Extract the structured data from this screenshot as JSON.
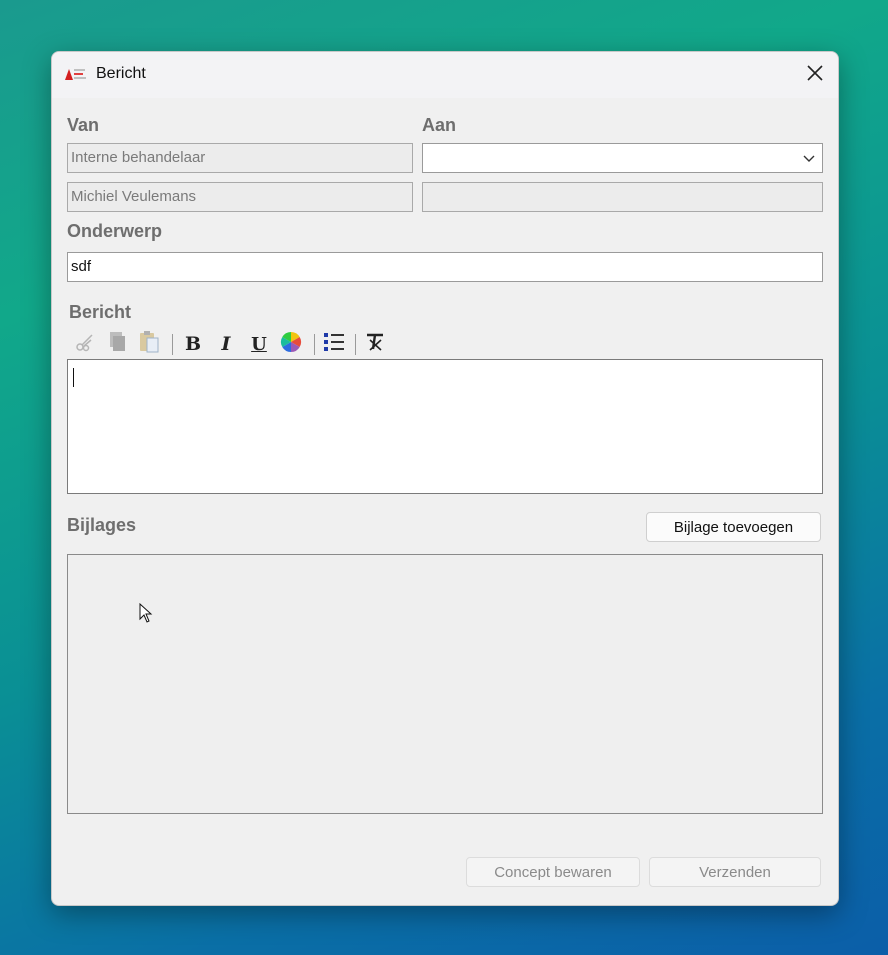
{
  "window": {
    "title": "Bericht"
  },
  "icons": {
    "app": "app-logo-icon",
    "close": "close-icon",
    "chevron": "chevron-down-icon",
    "cut": "scissors-icon",
    "copy": "copy-icon",
    "paste": "paste-icon",
    "bold": "bold-icon",
    "italic": "italic-icon",
    "underline": "underline-icon",
    "color": "color-wheel-icon",
    "list": "bullet-list-icon",
    "clear": "clear-format-icon"
  },
  "from": {
    "label": "Van",
    "sender_type": "Interne behandelaar",
    "sender_name": "Michiel Veulemans"
  },
  "to": {
    "label": "Aan",
    "selected": "",
    "detail": ""
  },
  "subject": {
    "label": "Onderwerp",
    "value": "sdf"
  },
  "message": {
    "label": "Bericht",
    "toolbar": {
      "bold": "B",
      "italic": "I",
      "underline": "U"
    },
    "body": ""
  },
  "attachments": {
    "label": "Bijlages",
    "add_button": "Bijlage toevoegen",
    "items": []
  },
  "footer": {
    "save_draft": "Concept bewaren",
    "send": "Verzenden"
  }
}
